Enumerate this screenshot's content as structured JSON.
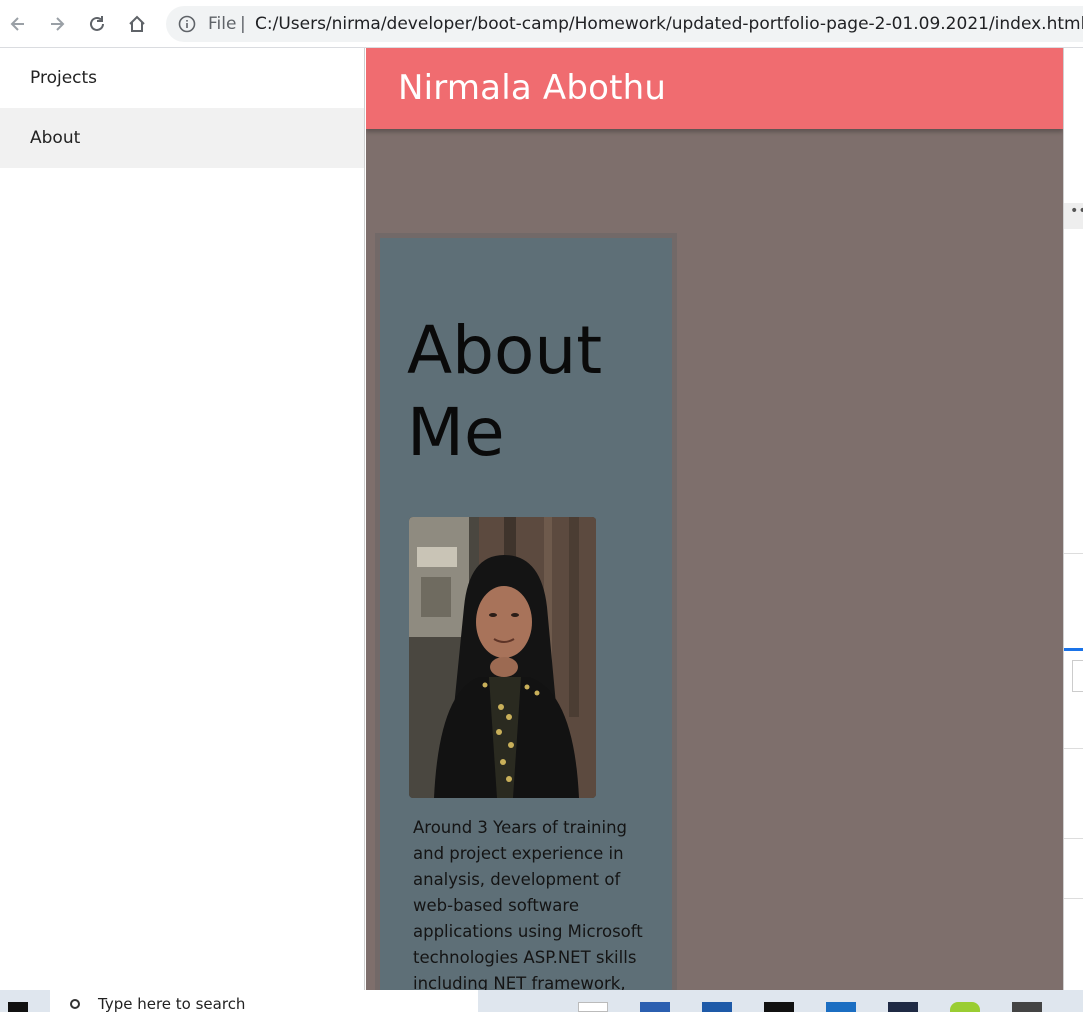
{
  "browser": {
    "nav": [
      "back",
      "forward",
      "reload",
      "home"
    ],
    "omnibox": {
      "scheme_label": "File",
      "separator": "|",
      "url": "C:/Users/nirma/developer/boot-camp/Homework/updated-portfolio-page-2-01.09.2021/index.html"
    }
  },
  "sidebar": {
    "items": [
      {
        "label": "Projects",
        "active": false
      },
      {
        "label": "About",
        "active": true
      }
    ]
  },
  "page": {
    "header_title": "Nirmala Abothu",
    "about": {
      "heading": "About Me",
      "photo_alt": "portrait photo",
      "text": "Around 3 Years of training and project experience in analysis, development of web-based software applications using Microsoft technologies ASP.NET skills including NET framework,"
    }
  },
  "colors": {
    "header": "#f06c70",
    "page_bg": "#7e6f6c",
    "card": "#5e6f77"
  },
  "taskbar": {
    "search_placeholder": "Type here to search"
  }
}
